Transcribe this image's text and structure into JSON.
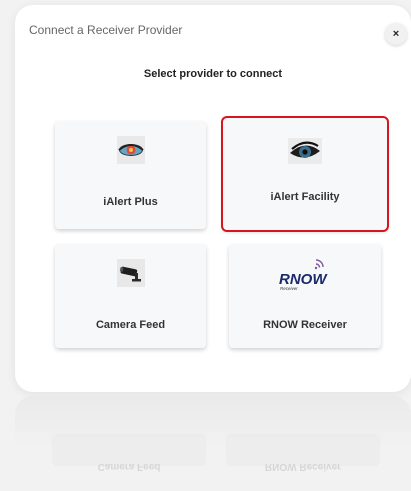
{
  "modal": {
    "title": "Connect a Receiver Provider",
    "close_label": "×",
    "subtitle": "Select provider to connect"
  },
  "providers": [
    {
      "label": "iAlert Plus",
      "icon": "colored-eye-icon",
      "selected": false
    },
    {
      "label": "iAlert Facility",
      "icon": "eye-icon",
      "selected": true
    },
    {
      "label": "Camera Feed",
      "icon": "security-camera-icon",
      "selected": false
    },
    {
      "label": "RNOW Receiver",
      "icon": "rnow-logo",
      "logo_text": "RNOW",
      "logo_subtext": "Receiver",
      "selected": false
    }
  ],
  "colors": {
    "selection_outline": "#d8141c",
    "card_background": "#f7f8f9",
    "modal_background": "#ffffff",
    "page_background": "#f2f2f2"
  }
}
